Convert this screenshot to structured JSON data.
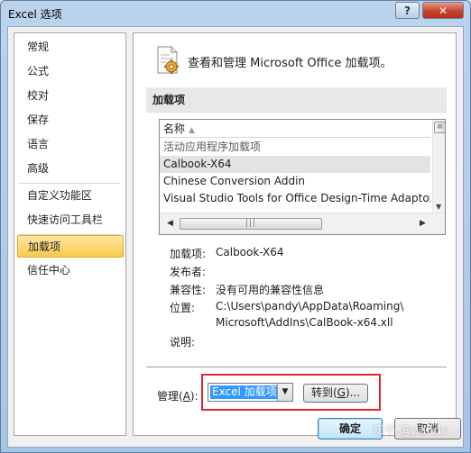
{
  "window": {
    "title": "Excel 选项",
    "help_button": "?",
    "close_button": "✕"
  },
  "sidebar": {
    "items": [
      {
        "label": "常规"
      },
      {
        "label": "公式"
      },
      {
        "label": "校对"
      },
      {
        "label": "保存"
      },
      {
        "label": "语言"
      },
      {
        "label": "高级"
      },
      {
        "label": "自定义功能区"
      },
      {
        "label": "快速访问工具栏"
      },
      {
        "label": "加载项",
        "selected": true
      },
      {
        "label": "信任中心"
      }
    ]
  },
  "main": {
    "header": "查看和管理 Microsoft Office 加载项。",
    "section_title": "加载项",
    "list": {
      "column_header": "名称",
      "sort_indicator": "▲",
      "rows": [
        {
          "text": "活动应用程序加载项",
          "kind": "group"
        },
        {
          "text": "Calbook-X64",
          "kind": "item",
          "selected": true
        },
        {
          "text": "Chinese Conversion Addin",
          "kind": "item"
        },
        {
          "text": "Visual Studio Tools for Office Design-Time Adaptor",
          "kind": "item"
        }
      ]
    },
    "details": {
      "addin_label": "加载项:",
      "addin_value": "Calbook-X64",
      "publisher_label": "发布者:",
      "publisher_value": "",
      "compat_label": "兼容性:",
      "compat_value": "没有可用的兼容性信息",
      "location_label": "位置:",
      "location_line1": "C:\\Users\\pandy\\AppData\\Roaming\\",
      "location_line2": "Microsoft\\AddIns\\CalBook-x64.xll",
      "desc_label": "说明:",
      "desc_value": ""
    },
    "manage": {
      "label": "管理(",
      "label_key": "A",
      "label_end": "):",
      "select_value": "Excel 加载项",
      "goto_label": "转到(",
      "goto_key": "G",
      "goto_end": ")..."
    }
  },
  "footer": {
    "ok_label": "确定",
    "cancel_label": "取消",
    "watermark": "知乎 @pandy"
  },
  "colors": {
    "selected_nav": "#f9c94f",
    "highlight_box": "#e0262c",
    "select_highlight": "#3399ff"
  }
}
